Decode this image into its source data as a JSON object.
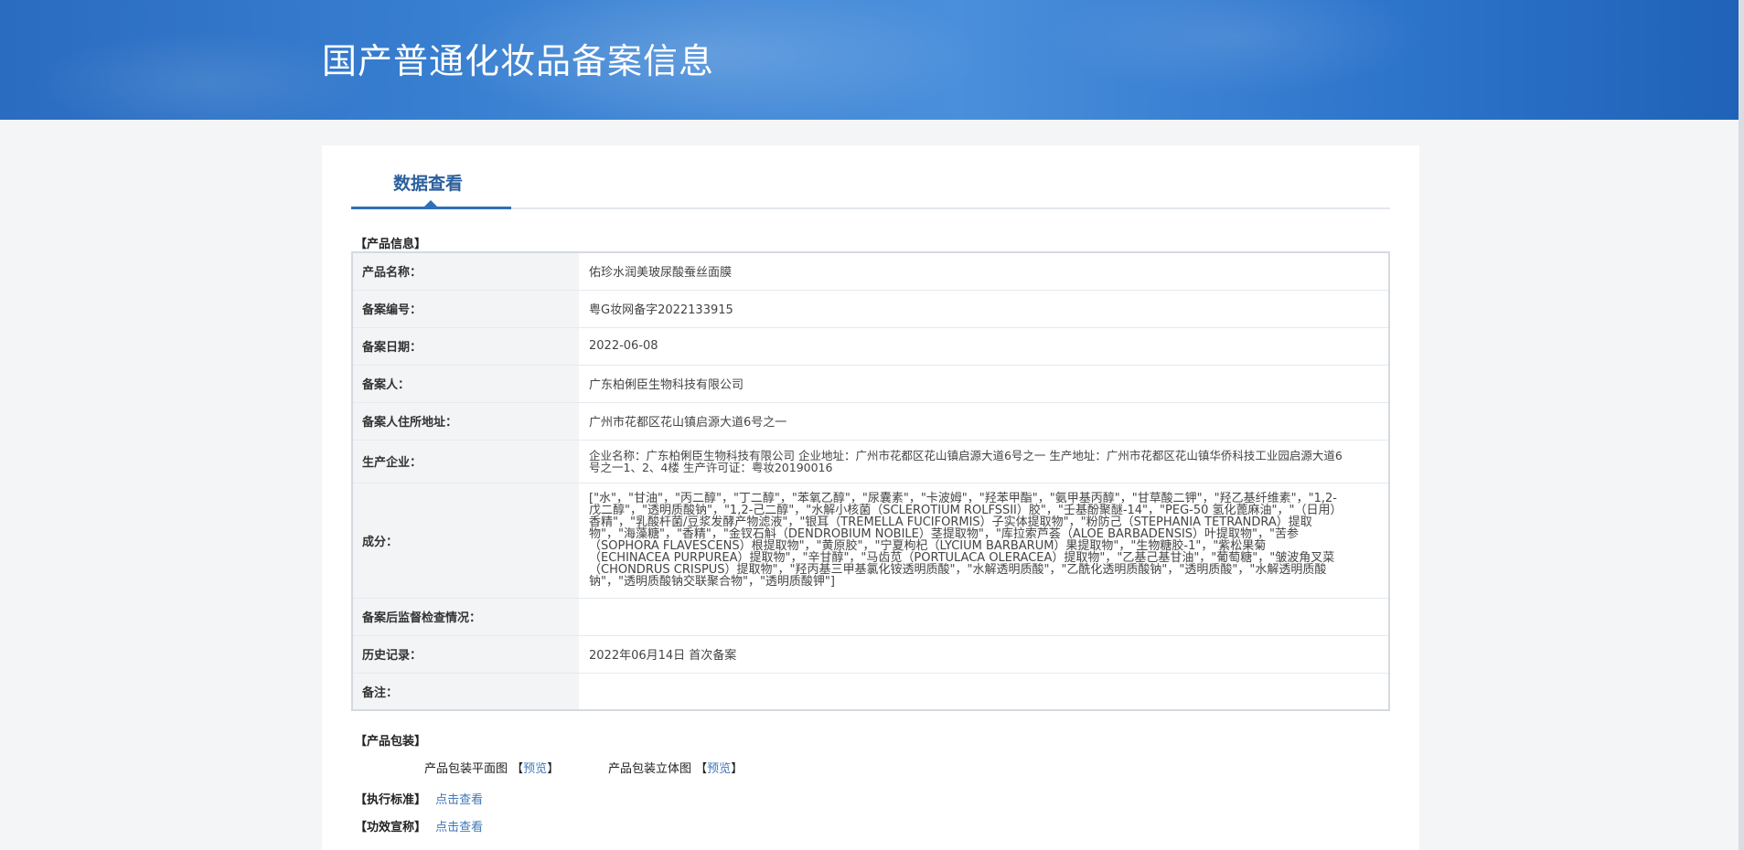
{
  "header": {
    "title": "国产普通化妆品备案信息"
  },
  "tab": {
    "label": "数据查看"
  },
  "sections": {
    "product_info": "【产品信息】",
    "packaging": "【产品包装】",
    "standard": "【执行标准】",
    "efficacy": "【功效宣称】"
  },
  "product": {
    "rows": [
      {
        "label": "产品名称：",
        "value": "佑珍水润美玻尿酸蚕丝面膜"
      },
      {
        "label": "备案编号：",
        "value": "粤G妆网备字2022133915"
      },
      {
        "label": "备案日期：",
        "value": "2022-06-08"
      },
      {
        "label": "备案人：",
        "value": "广东柏俐臣生物科技有限公司"
      },
      {
        "label": "备案人住所地址：",
        "value": "广州市花都区花山镇启源大道6号之一"
      },
      {
        "label": "生产企业：",
        "value": "企业名称：广东柏俐臣生物科技有限公司 企业地址：广州市花都区花山镇启源大道6号之一 生产地址：广州市花都区花山镇华侨科技工业园启源大道6号之一1、2、4楼 生产许可证：粤妆20190016"
      },
      {
        "label": "成分：",
        "value": "[\"水\"，\"甘油\"，\"丙二醇\"，\"丁二醇\"，\"苯氧乙醇\"，\"尿囊素\"，\"卡波姆\"，\"羟苯甲酯\"，\"氨甲基丙醇\"，\"甘草酸二钾\"，\"羟乙基纤维素\"，\"1,2-戊二醇\"，\"透明质酸钠\"，\"1,2-己二醇\"，\"水解小核菌（SCLEROTIUM ROLFSSII）胶\"，\"壬基酚聚醚-14\"，\"PEG-50 氢化蓖麻油\"，\"（日用）香精\"，\"乳酸杆菌/豆浆发酵产物滤液\"，\"银耳（TREMELLA FUCIFORMIS）子实体提取物\"，\"粉防己（STEPHANIA TETRANDRA）提取物\"，\"海藻糖\"，\"香精\"，\"金钗石斛（DENDROBIUM NOBILE）茎提取物\"，\"库拉索芦荟（ALOE BARBADENSIS）叶提取物\"，\"苦参（SOPHORA FLAVESCENS）根提取物\"，\"黄原胶\"，\"宁夏枸杞（LYCIUM BARBARUM）果提取物\"，\"生物糖胶-1\"，\"紫松果菊（ECHINACEA PURPUREA）提取物\"，\"辛甘醇\"，\"马齿苋（PORTULACA OLERACEA）提取物\"，\"乙基己基甘油\"，\"葡萄糖\"，\"皱波角叉菜（CHONDRUS CRISPUS）提取物\"，\"羟丙基三甲基氯化铵透明质酸\"，\"水解透明质酸\"，\"乙酰化透明质酸钠\"，\"透明质酸\"，\"水解透明质酸钠\"，\"透明质酸钠交联聚合物\"，\"透明质酸钾\"]"
      },
      {
        "label": "备案后监督检查情况：",
        "value": ""
      },
      {
        "label": "历史记录：",
        "value": "2022年06月14日 首次备案"
      },
      {
        "label": "备注：",
        "value": ""
      }
    ]
  },
  "packaging": {
    "flat_label": "产品包装平面图",
    "flat_link": "预览",
    "stereo_label": "产品包装立体图",
    "stereo_link": "预览",
    "bracket_open": "【",
    "bracket_close": "】"
  },
  "links": {
    "standard": "点击查看",
    "efficacy": "点击查看"
  }
}
